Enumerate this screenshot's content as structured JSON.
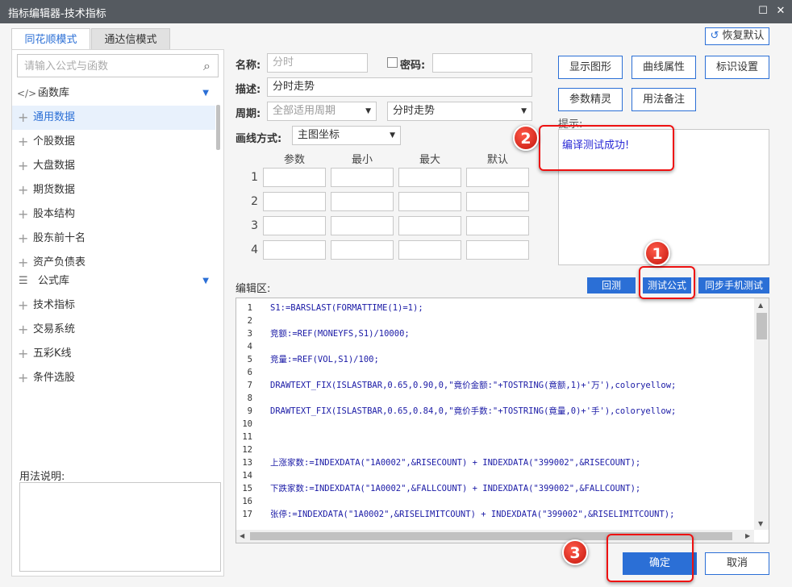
{
  "window": {
    "title": "指标编辑器-技术指标"
  },
  "tabs": [
    {
      "label": "同花顺模式"
    },
    {
      "label": "通达信模式"
    }
  ],
  "restore_label": "恢复默认",
  "sidebar": {
    "search_placeholder": "请输入公式与函数",
    "function_lib": "函数库",
    "function_items": [
      "通用数据",
      "个股数据",
      "大盘数据",
      "期货数据",
      "股本结构",
      "股东前十名",
      "资产负债表"
    ],
    "formula_lib": "公式库",
    "formula_items": [
      "技术指标",
      "交易系统",
      "五彩K线",
      "条件选股"
    ],
    "usage_label": "用法说明:"
  },
  "form": {
    "name_label": "名称:",
    "name_value": "分时",
    "password_label": "密码:",
    "desc_label": "描述:",
    "desc_value": "分时走势",
    "period_label": "周期:",
    "period_value": "全部适用周期",
    "period2_value": "分时走势",
    "draw_label": "画线方式:",
    "draw_value": "主图坐标",
    "param_headers": [
      "参数",
      "最小",
      "最大",
      "默认"
    ],
    "param_rows": [
      "1",
      "2",
      "3",
      "4"
    ]
  },
  "right_buttons": [
    "显示图形",
    "曲线属性",
    "标识设置",
    "参数精灵",
    "用法备注"
  ],
  "hint": {
    "label": "提示:",
    "text": "编译测试成功!"
  },
  "editor": {
    "label": "编辑区:",
    "buttons": [
      "回测",
      "测试公式",
      "同步手机测试"
    ],
    "lines": [
      {
        "n": "1",
        "t": "S1:=BARSLAST(FORMATTIME(1)=1);"
      },
      {
        "n": "2",
        "t": ""
      },
      {
        "n": "3",
        "t": "竞额:=REF(MONEYFS,S1)/10000;"
      },
      {
        "n": "4",
        "t": ""
      },
      {
        "n": "5",
        "t": "竞量:=REF(VOL,S1)/100;"
      },
      {
        "n": "6",
        "t": ""
      },
      {
        "n": "7",
        "t": "DRAWTEXT_FIX(ISLASTBAR,0.65,0.90,0,\"竟价金额:\"+TOSTRING(竟额,1)+'万'),coloryellow;"
      },
      {
        "n": "8",
        "t": ""
      },
      {
        "n": "9",
        "t": "DRAWTEXT_FIX(ISLASTBAR,0.65,0.84,0,\"竟价手数:\"+TOSTRING(竟量,0)+'手'),coloryellow;"
      },
      {
        "n": "10",
        "t": ""
      },
      {
        "n": "11",
        "t": ""
      },
      {
        "n": "12",
        "t": ""
      },
      {
        "n": "13",
        "t": "上涨家数:=INDEXDATA(\"1A0002\",&RISECOUNT) + INDEXDATA(\"399002\",&RISECOUNT);"
      },
      {
        "n": "14",
        "t": ""
      },
      {
        "n": "15",
        "t": "下跌家数:=INDEXDATA(\"1A0002\",&FALLCOUNT) + INDEXDATA(\"399002\",&FALLCOUNT);"
      },
      {
        "n": "16",
        "t": ""
      },
      {
        "n": "17",
        "t": "张停:=INDEXDATA(\"1A0002\",&RISELIMITCOUNT) + INDEXDATA(\"399002\",&RISELIMITCOUNT);"
      }
    ]
  },
  "footer": {
    "ok": "确定",
    "cancel": "取消"
  },
  "badges": [
    "1",
    "2",
    "3"
  ],
  "colors": {
    "accent": "#2b6fd6",
    "highlight": "#e11111",
    "titlebar": "#555a60",
    "hint_text": "#2b2bd6"
  }
}
